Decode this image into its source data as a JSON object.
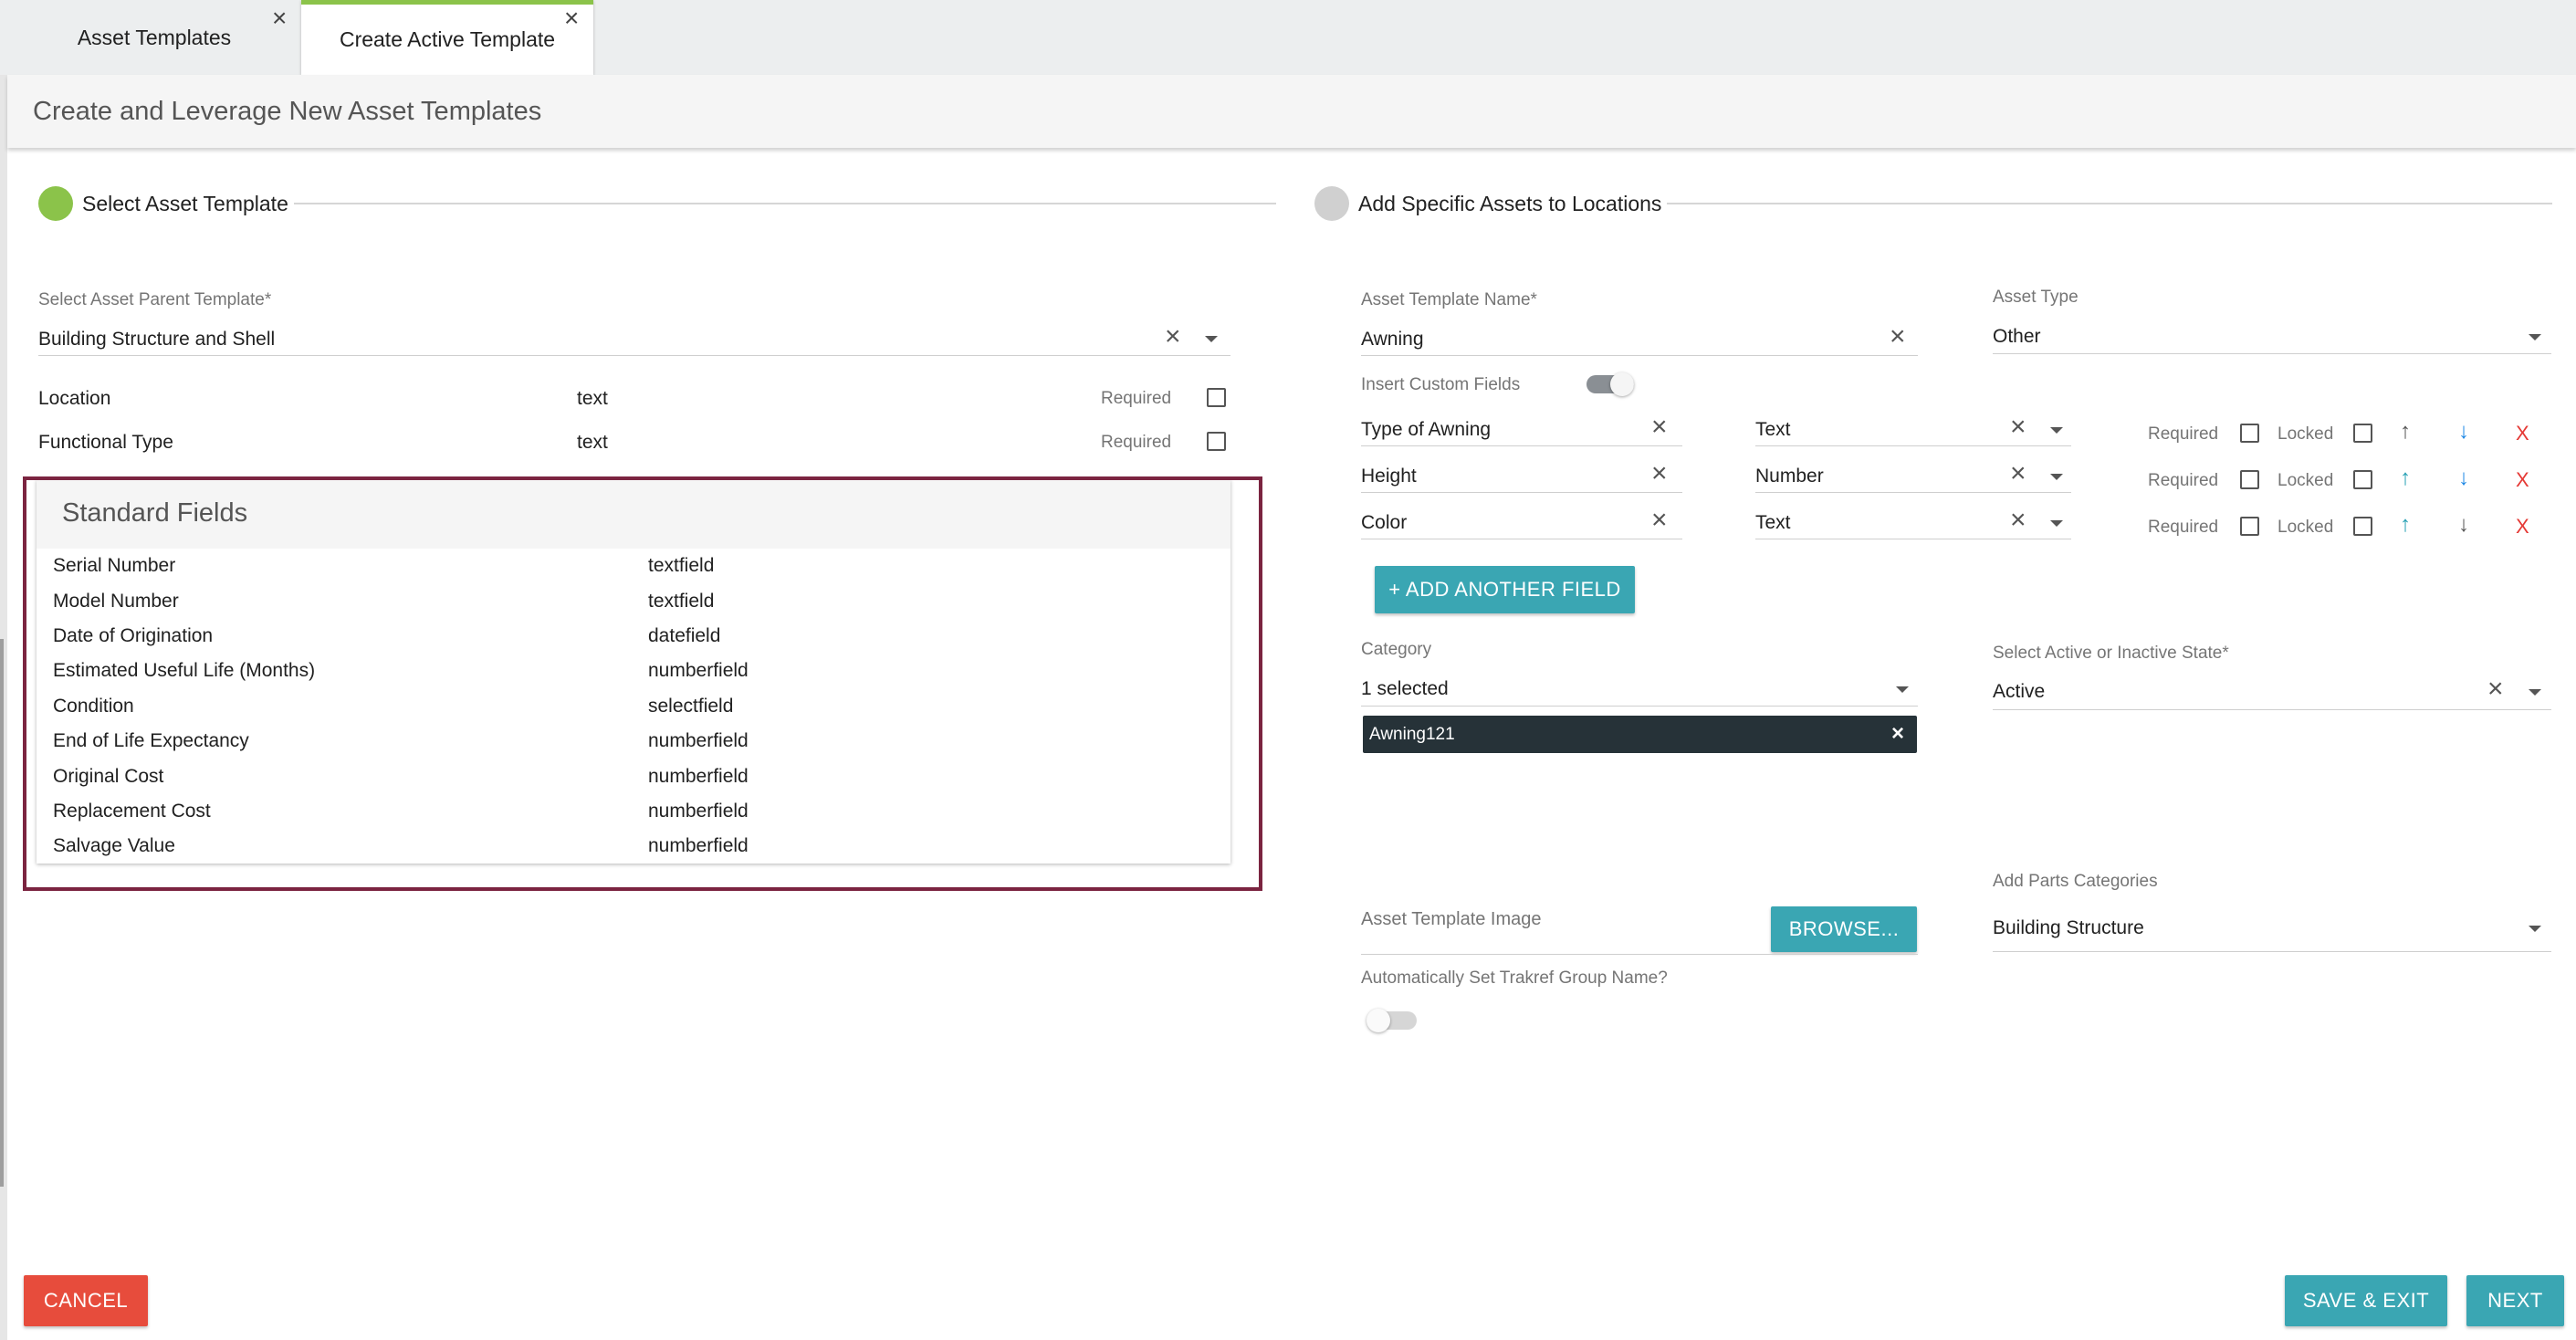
{
  "tabs": [
    {
      "label": "Asset Templates"
    },
    {
      "label": "Create Active Template"
    }
  ],
  "page_title": "Create and Leverage New Asset Templates",
  "stepper": {
    "step1": "Select Asset Template",
    "step2": "Add Specific Assets to Locations"
  },
  "left": {
    "parent_template_label": "Select Asset Parent Template*",
    "parent_template_value": "Building Structure and Shell",
    "fields": [
      {
        "name": "Location",
        "type": "text",
        "required_label": "Required"
      },
      {
        "name": "Functional Type",
        "type": "text",
        "required_label": "Required"
      }
    ],
    "standard_fields_title": "Standard Fields",
    "standard_fields": [
      {
        "name": "Serial Number",
        "type": "textfield"
      },
      {
        "name": "Model Number",
        "type": "textfield"
      },
      {
        "name": "Date of Origination",
        "type": "datefield"
      },
      {
        "name": "Estimated Useful Life (Months)",
        "type": "numberfield"
      },
      {
        "name": "Condition",
        "type": "selectfield"
      },
      {
        "name": "End of Life Expectancy",
        "type": "numberfield"
      },
      {
        "name": "Original Cost",
        "type": "numberfield"
      },
      {
        "name": "Replacement Cost",
        "type": "numberfield"
      },
      {
        "name": "Salvage Value",
        "type": "numberfield"
      }
    ]
  },
  "right": {
    "template_name_label": "Asset Template Name*",
    "template_name_value": "Awning",
    "asset_type_label": "Asset Type",
    "asset_type_value": "Other",
    "insert_custom_label": "Insert Custom Fields",
    "custom_fields": [
      {
        "name": "Type of Awning",
        "type": "Text",
        "required_label": "Required",
        "locked_label": "Locked"
      },
      {
        "name": "Height",
        "type": "Number",
        "required_label": "Required",
        "locked_label": "Locked"
      },
      {
        "name": "Color",
        "type": "Text",
        "required_label": "Required",
        "locked_label": "Locked"
      }
    ],
    "add_field_button": "+ ADD ANOTHER FIELD",
    "category_label": "Category",
    "category_value": "1 selected",
    "category_chip": "Awning121",
    "state_label": "Select Active or Inactive State*",
    "state_value": "Active",
    "parts_label": "Add Parts Categories",
    "parts_value": "Building Structure",
    "image_label": "Asset Template Image",
    "browse_button": "BROWSE...",
    "auto_group_label": "Automatically Set Trakref Group Name?"
  },
  "footer": {
    "cancel": "CANCEL",
    "save_exit": "SAVE & EXIT",
    "next": "NEXT"
  },
  "colors": {
    "accent_green": "#8bc34a",
    "teal": "#3aa6b3",
    "cancel_red": "#e74c3c",
    "highlight_border": "#7b2440"
  }
}
